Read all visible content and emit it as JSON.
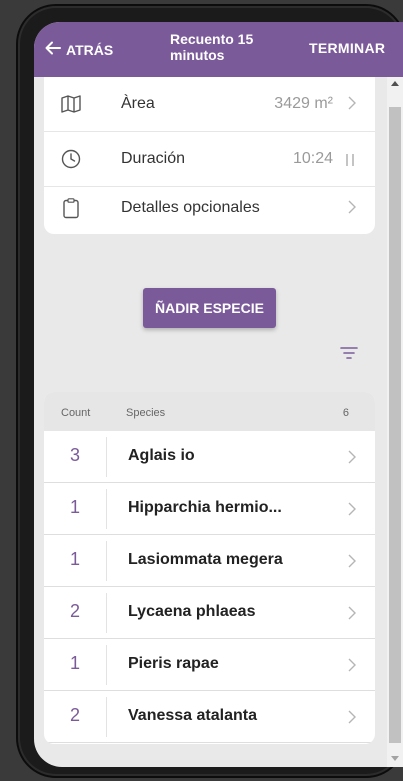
{
  "appbar": {
    "back_label": "ATRÁS",
    "title": "Recuento 15 minutos",
    "finish_label": "TERMINAR"
  },
  "details": [
    {
      "icon": "map-icon",
      "label": "Àrea",
      "value": "3429 m²",
      "action": "chevron-right-icon"
    },
    {
      "icon": "clock-icon",
      "label": "Duración",
      "value": "10:24",
      "action": "pause-icon"
    },
    {
      "icon": "clipboard-icon",
      "label": "Detalles opcionales",
      "value": "",
      "action": "chevron-right-icon"
    }
  ],
  "add_species_label": "ÑADIR ESPECIE",
  "species_list": {
    "header": {
      "count": "Count",
      "species": "Species",
      "total": "6"
    },
    "rows": [
      {
        "count": "3",
        "name": "Aglais io"
      },
      {
        "count": "1",
        "name": "Hipparchia hermio..."
      },
      {
        "count": "1",
        "name": "Lasiommata megera"
      },
      {
        "count": "2",
        "name": "Lycaena phlaeas"
      },
      {
        "count": "1",
        "name": "Pieris rapae"
      },
      {
        "count": "2",
        "name": "Vanessa atalanta"
      }
    ]
  },
  "colors": {
    "accent": "#7b5a9a",
    "background": "#e9e9e9"
  }
}
